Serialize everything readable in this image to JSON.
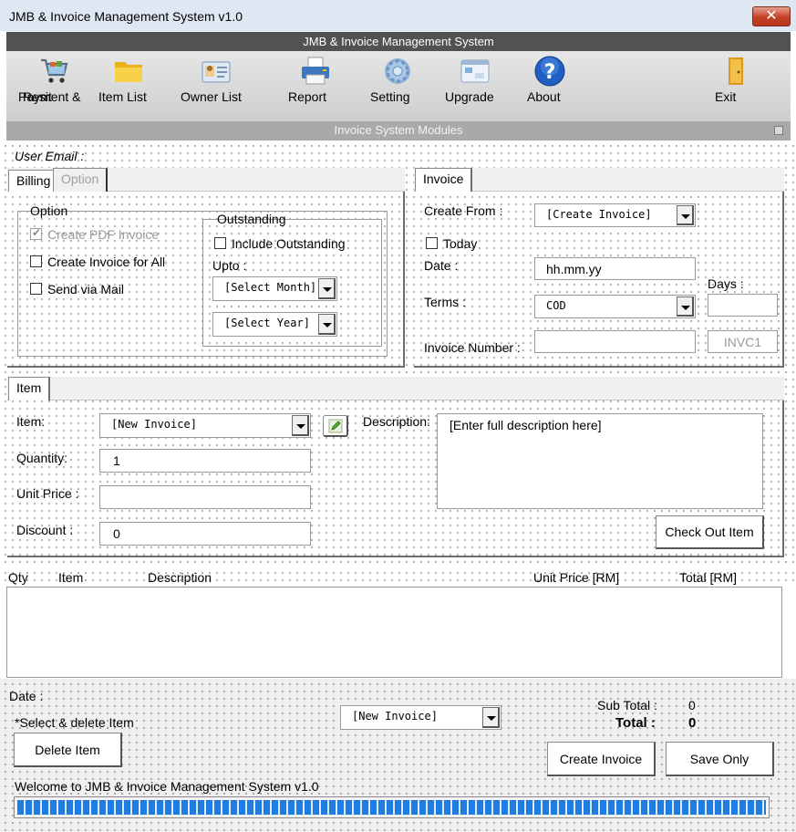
{
  "window": {
    "title": "JMB & Invoice Management System v1.0",
    "close_glyph": "✕"
  },
  "ribbon": {
    "header": "JMB & Invoice Management System",
    "footer": "Invoice System Modules",
    "buttons": [
      {
        "label": "Payment &",
        "label2": "Resit",
        "icon": "shopping-cart-icon"
      },
      {
        "label": "Item List",
        "icon": "folder-icon"
      },
      {
        "label": "Owner List",
        "icon": "contact-card-icon"
      },
      {
        "label": "Report",
        "icon": "printer-icon"
      },
      {
        "label": "Setting",
        "icon": "gear-icon"
      },
      {
        "label": "Upgrade",
        "icon": "upgrade-window-icon"
      },
      {
        "label": "About",
        "icon": "help-icon"
      },
      {
        "label": "Exit",
        "icon": "exit-door-icon"
      }
    ]
  },
  "user_email_label": "User Email :",
  "billing": {
    "tabs": [
      "Billing",
      "Option"
    ],
    "option_group": "Option",
    "create_pdf": "Create PDF Invoice",
    "create_for_all": "Create Invoice for All",
    "send_mail": "Send via Mail",
    "outstanding_group": "Outstanding",
    "include_outstanding": "Include Outstanding",
    "upto_label": "Upto :",
    "select_month": "[Select Month]",
    "select_year": "[Select Year]"
  },
  "invoice": {
    "tab": "Invoice",
    "create_from_label": "Create From :",
    "create_from_value": "[Create Invoice]",
    "today_label": "Today",
    "date_label": "Date :",
    "date_value": "hh.mm.yy",
    "terms_label": "Terms :",
    "terms_value": "COD",
    "days_label": "Days :",
    "days_value": "",
    "invoice_number_label": "Invoice Number :",
    "invoice_number_value": "",
    "invoice_prefix": "INVC1"
  },
  "item": {
    "tab": "Item",
    "item_label": "Item:",
    "item_value": "[New Invoice]",
    "quantity_label": "Quantity:",
    "quantity_value": "1",
    "unit_price_label": "Unit Price :",
    "unit_price_value": "",
    "discount_label": "Discount :",
    "discount_value": "0",
    "description_label": "Description:",
    "description_value": "[Enter full description here]",
    "checkout_button": "Check Out Item"
  },
  "table": {
    "headers": [
      "Qty",
      "Item",
      "Description",
      "Unit Price [RM]",
      "Total [RM]"
    ]
  },
  "footer": {
    "date_label": "Date :",
    "select_delete_hint": "*Select & delete Item",
    "delete_button": "Delete Item",
    "invoice_combo": "[New Invoice]",
    "subtotal_label": "Sub Total :",
    "subtotal_value": "0",
    "total_label": "Total :",
    "total_value": "0",
    "create_invoice_button": "Create Invoice",
    "save_only_button": "Save Only",
    "welcome": "Welcome to JMB & Invoice Management System v1.0",
    "progress": 1.0
  }
}
